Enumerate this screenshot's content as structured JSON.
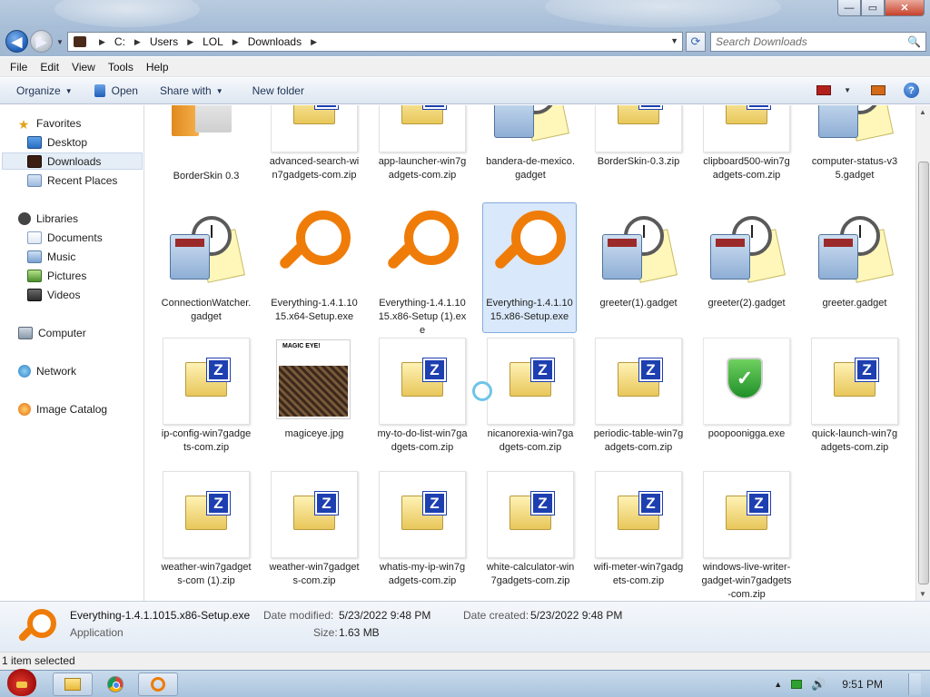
{
  "window": {
    "minimize_glyph": "—",
    "maximize_glyph": "▭",
    "close_glyph": "✕"
  },
  "address": {
    "back_glyph": "◀",
    "forward_glyph": "▶",
    "crumbs": [
      "C:",
      "Users",
      "LOL",
      "Downloads"
    ],
    "search_placeholder": "Search Downloads",
    "refresh_glyph": "⟳",
    "search_icon": "🔍"
  },
  "menu": [
    "File",
    "Edit",
    "View",
    "Tools",
    "Help"
  ],
  "commands": {
    "organize": "Organize",
    "open": "Open",
    "share_with": "Share with",
    "new_folder": "New folder",
    "help_glyph": "?"
  },
  "nav": {
    "favorites": "Favorites",
    "desktop": "Desktop",
    "downloads": "Downloads",
    "recent_places": "Recent Places",
    "libraries": "Libraries",
    "documents": "Documents",
    "music": "Music",
    "pictures": "Pictures",
    "videos": "Videos",
    "computer": "Computer",
    "network": "Network",
    "image_catalog": "Image Catalog"
  },
  "files": [
    {
      "name": "BorderSkin 0.3",
      "icon": "folder-icon"
    },
    {
      "name": "advanced-search-win7gadgets-com.zip",
      "icon": "zip-icon"
    },
    {
      "name": "app-launcher-win7gadgets-com.zip",
      "icon": "zip-icon"
    },
    {
      "name": "bandera-de-mexico.gadget",
      "icon": "gadget-icon"
    },
    {
      "name": "BorderSkin-0.3.zip",
      "icon": "zip-icon"
    },
    {
      "name": "clipboard500-win7gadgets-com.zip",
      "icon": "zip-icon"
    },
    {
      "name": "computer-status-v35.gadget",
      "icon": "gadget-icon"
    },
    {
      "name": "ConnectionWatcher.gadget",
      "icon": "gadget-icon"
    },
    {
      "name": "Everything-1.4.1.1015.x64-Setup.exe",
      "icon": "everything-search-icon"
    },
    {
      "name": "Everything-1.4.1.1015.x86-Setup (1).exe",
      "icon": "everything-search-icon"
    },
    {
      "name": "Everything-1.4.1.1015.x86-Setup.exe",
      "icon": "everything-search-icon"
    },
    {
      "name": "greeter(1).gadget",
      "icon": "gadget-icon"
    },
    {
      "name": "greeter(2).gadget",
      "icon": "gadget-icon"
    },
    {
      "name": "greeter.gadget",
      "icon": "gadget-icon"
    },
    {
      "name": "ip-config-win7gadgets-com.zip",
      "icon": "zip-icon"
    },
    {
      "name": "magiceye.jpg",
      "icon": "image-thumbnail"
    },
    {
      "name": "my-to-do-list-win7gadgets-com.zip",
      "icon": "zip-icon"
    },
    {
      "name": "nicanorexia-win7gadgets-com.zip",
      "icon": "zip-icon"
    },
    {
      "name": "periodic-table-win7gadgets-com.zip",
      "icon": "zip-icon"
    },
    {
      "name": "poopoonigga.exe",
      "icon": "shield-icon"
    },
    {
      "name": "quick-launch-win7gadgets-com.zip",
      "icon": "zip-icon"
    },
    {
      "name": "weather-win7gadgets-com (1).zip",
      "icon": "zip-icon"
    },
    {
      "name": "weather-win7gadgets-com.zip",
      "icon": "zip-icon"
    },
    {
      "name": "whatis-my-ip-win7gadgets-com.zip",
      "icon": "zip-icon"
    },
    {
      "name": "white-calculator-win7gadgets-com.zip",
      "icon": "zip-icon"
    },
    {
      "name": "wifi-meter-win7gadgets-com.zip",
      "icon": "zip-icon"
    },
    {
      "name": "windows-live-writer-gadget-win7gadgets-com.zip",
      "icon": "zip-icon"
    }
  ],
  "thumb_text": {
    "magiceye_caption": "MAGIC EYE!"
  },
  "details": {
    "name": "Everything-1.4.1.1015.x86-Setup.exe",
    "type": "Application",
    "date_modified_label": "Date modified:",
    "date_modified": "5/23/2022 9:48 PM",
    "size_label": "Size:",
    "size": "1.63 MB",
    "date_created_label": "Date created:",
    "date_created": "5/23/2022 9:48 PM"
  },
  "status": {
    "text": "1 item selected"
  },
  "taskbar": {
    "clock": "9:51 PM"
  }
}
